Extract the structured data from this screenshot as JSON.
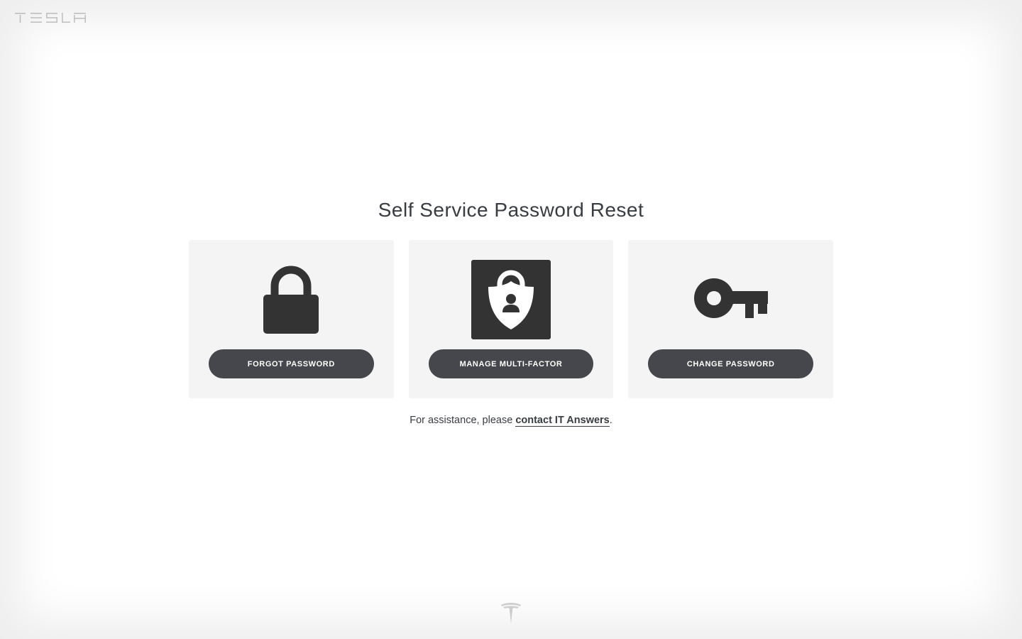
{
  "header": {
    "brand_name": "TESLA",
    "brand_logo_icon": "tesla-wordmark-icon"
  },
  "main": {
    "title": "Self Service Password Reset",
    "cards": [
      {
        "icon": "padlock-icon",
        "button_label": "FORGOT PASSWORD"
      },
      {
        "icon": "shield-lock-user-icon",
        "button_label": "MANAGE MULTI-FACTOR"
      },
      {
        "icon": "key-icon",
        "button_label": "CHANGE PASSWORD"
      }
    ],
    "assistance": {
      "prefix": "For assistance, please ",
      "link_text": "contact IT Answers",
      "suffix": "."
    }
  },
  "footer": {
    "logo_icon": "tesla-t-icon"
  },
  "colors": {
    "text": "#393c41",
    "card_bg": "#f4f4f4",
    "button_bg": "#45474c",
    "icon": "#333333"
  }
}
